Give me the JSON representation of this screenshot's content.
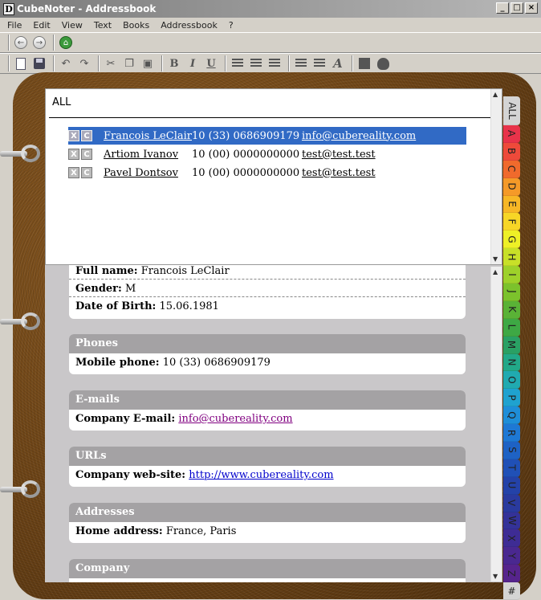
{
  "window": {
    "title": "CubeNoter - Addressbook",
    "app_icon_letter": "D",
    "controls": [
      "_",
      "□",
      "×"
    ]
  },
  "menu": [
    "File",
    "Edit",
    "View",
    "Text",
    "Books",
    "Addressbook",
    "?"
  ],
  "toolbar_text": {
    "bold": "B",
    "italic": "I",
    "underline": "U"
  },
  "list": {
    "header": "ALL",
    "action_delete": "X",
    "action_copy": "C",
    "rows": [
      {
        "name": "Francois LeClair",
        "phone": "10 (33) 0686909179",
        "email": "info@cubereality.com",
        "selected": true
      },
      {
        "name": "Artiom Ivanov",
        "phone": "10 (00) 0000000000",
        "email": "test@test.test",
        "selected": false
      },
      {
        "name": "Pavel Dontsov",
        "phone": "10 (00) 0000000000",
        "email": "test@test.test",
        "selected": false
      }
    ]
  },
  "details": {
    "general": [
      {
        "label": "Full name:",
        "value": "Francois LeClair"
      },
      {
        "label": "Gender:",
        "value": "M"
      },
      {
        "label": "Date of Birth:",
        "value": "15.06.1981"
      }
    ],
    "sections": [
      {
        "title": "Phones",
        "label": "Mobile phone:",
        "value": "10 (33) 0686909179"
      },
      {
        "title": "E-mails",
        "label": "Company E-mail:",
        "value": "info@cubereality.com"
      },
      {
        "title": "URLs",
        "label": "Company web-site:",
        "value": "http://www.cubereality.com"
      },
      {
        "title": "Addresses",
        "label": "Home address:",
        "value": "France, Paris"
      },
      {
        "title": "Company"
      }
    ]
  },
  "tabs": [
    {
      "label": "ALL",
      "color": "#d4d4d4"
    },
    {
      "label": "A",
      "color": "#e8334a"
    },
    {
      "label": "B",
      "color": "#ee4a3a"
    },
    {
      "label": "C",
      "color": "#f06a2c"
    },
    {
      "label": "D",
      "color": "#f59a28"
    },
    {
      "label": "E",
      "color": "#f7b726"
    },
    {
      "label": "F",
      "color": "#f7d626"
    },
    {
      "label": "G",
      "color": "#eef026"
    },
    {
      "label": "H",
      "color": "#c8e028"
    },
    {
      "label": "I",
      "color": "#9ed12a"
    },
    {
      "label": "J",
      "color": "#7cc22c"
    },
    {
      "label": "K",
      "color": "#5ab236"
    },
    {
      "label": "L",
      "color": "#3ea844"
    },
    {
      "label": "M",
      "color": "#2aa064"
    },
    {
      "label": "N",
      "color": "#22a888"
    },
    {
      "label": "O",
      "color": "#20aab0"
    },
    {
      "label": "P",
      "color": "#1fa2cf"
    },
    {
      "label": "Q",
      "color": "#1e8ed8"
    },
    {
      "label": "R",
      "color": "#1e78d4"
    },
    {
      "label": "S",
      "color": "#1e62c4"
    },
    {
      "label": "T",
      "color": "#2050b6"
    },
    {
      "label": "U",
      "color": "#2442a8"
    },
    {
      "label": "V",
      "color": "#2a3a9e"
    },
    {
      "label": "W",
      "color": "#343298"
    },
    {
      "label": "X",
      "color": "#3e2c94"
    },
    {
      "label": "Y",
      "color": "#4a2890"
    },
    {
      "label": "Z",
      "color": "#56248c"
    },
    {
      "label": "#",
      "color": "#d4d4d4"
    }
  ]
}
